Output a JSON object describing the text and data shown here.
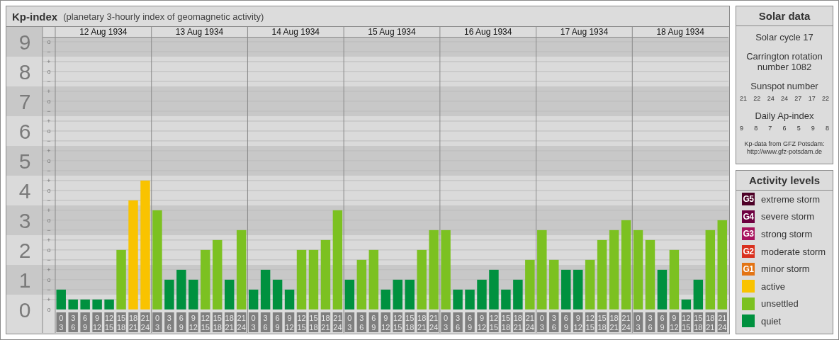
{
  "header": {
    "title": "Kp-index",
    "subtitle": "(planetary 3-hourly index of geomagnetic activity)"
  },
  "chart": {
    "dates": [
      "12 Aug 1934",
      "13 Aug 1934",
      "14 Aug 1934",
      "15 Aug 1934",
      "16 Aug 1934",
      "17 Aug 1934",
      "18 Aug 1934"
    ],
    "kp_signs": [
      "o",
      "−",
      "+",
      "o",
      "−",
      "+",
      "o",
      "−",
      "+",
      "o",
      "−",
      "+",
      "o",
      "−",
      "+",
      "o",
      "−",
      "+",
      "o",
      "−",
      "+",
      "o",
      "−",
      "+",
      "o",
      "−",
      "+",
      "o"
    ],
    "chart_data": {
      "type": "bar",
      "stacked": true,
      "grid": true,
      "categories": [
        "0\n3",
        "3\n6",
        "6\n9",
        "9\n12",
        "12\n15",
        "15\n18",
        "18\n21",
        "21\n24",
        "0\n3",
        "3\n6",
        "6\n9",
        "9\n12",
        "12\n15",
        "15\n18",
        "18\n21",
        "21\n24",
        "0\n3",
        "3\n6",
        "6\n9",
        "9\n12",
        "12\n15",
        "15\n18",
        "18\n21",
        "21\n24",
        "0\n3",
        "3\n6",
        "6\n9",
        "9\n12",
        "12\n15",
        "15\n18",
        "18\n21",
        "21\n24",
        "0\n3",
        "3\n6",
        "6\n9",
        "9\n12",
        "12\n15",
        "15\n18",
        "18\n21",
        "21\n24",
        "0\n3",
        "3\n6",
        "6\n9",
        "9\n12",
        "12\n15",
        "15\n18",
        "18\n21",
        "21\n24",
        "0\n3",
        "3\n6",
        "6\n9",
        "9\n12",
        "12\n15",
        "15\n18",
        "18\n21",
        "21\n24"
      ],
      "ylim": [
        -0.79,
        9.5
      ],
      "yticks": [
        0,
        1,
        2,
        3,
        4,
        5,
        6,
        7,
        8,
        9
      ],
      "series": [
        {
          "color": "#00913f",
          "values": [
            0.67,
            0.33,
            0.33,
            0.33,
            0.33,
            null,
            null,
            null,
            null,
            1,
            1.33,
            1,
            null,
            null,
            1,
            null,
            0.67,
            1.33,
            1,
            0.67,
            null,
            null,
            null,
            null,
            1,
            null,
            null,
            0.67,
            1,
            1,
            null,
            null,
            null,
            0.67,
            0.67,
            1,
            1.33,
            0.67,
            1,
            null,
            null,
            null,
            1.33,
            1.33,
            null,
            null,
            null,
            null,
            null,
            null,
            1.33,
            null,
            0.33,
            1,
            null,
            null
          ]
        },
        {
          "color": "#7cc121",
          "values": [
            null,
            null,
            null,
            null,
            null,
            2,
            null,
            null,
            3.33,
            null,
            null,
            null,
            2,
            2.33,
            null,
            2.67,
            null,
            null,
            null,
            null,
            2,
            2,
            2.33,
            3.33,
            null,
            1.67,
            2,
            null,
            null,
            null,
            2,
            2.67,
            2.67,
            null,
            null,
            null,
            null,
            null,
            null,
            1.67,
            2.67,
            1.67,
            null,
            null,
            1.67,
            2.33,
            2.67,
            3,
            2.67,
            2.33,
            null,
            2,
            null,
            null,
            2.67,
            3
          ]
        },
        {
          "color": "#f9c300",
          "values": [
            null,
            null,
            null,
            null,
            null,
            null,
            3.67,
            4.33,
            null,
            null,
            null,
            null,
            null,
            null,
            null,
            null,
            null,
            null,
            null,
            null,
            null,
            null,
            null,
            null,
            null,
            null,
            null,
            null,
            null,
            null,
            null,
            null,
            null,
            null,
            null,
            null,
            null,
            null,
            null,
            null,
            null,
            null,
            null,
            null,
            null,
            null,
            null,
            null,
            null,
            null,
            null,
            null,
            null,
            null,
            null,
            null
          ]
        }
      ]
    }
  },
  "solar_data": {
    "title": "Solar data",
    "solar_cycle": "Solar cycle 17",
    "carrington": "Carrington rotation number 1082",
    "sunspot_label": "Sunspot number",
    "sunspot_values": [
      "21",
      "22",
      "24",
      "24",
      "27",
      "17",
      "22"
    ],
    "ap_label": "Daily Ap-index",
    "ap_values": [
      "9",
      "8",
      "7",
      "6",
      "5",
      "9",
      "8"
    ],
    "credit": "Kp-data from GFZ Potsdam:",
    "credit_url": "http://www.gfz-potsdam.de"
  },
  "activity_levels": {
    "title": "Activity levels",
    "items": [
      {
        "badge": "G5",
        "label": "extreme storm",
        "color": "#4d0026"
      },
      {
        "badge": "G4",
        "label": "severe storm",
        "color": "#6e0040"
      },
      {
        "badge": "G3",
        "label": "strong storm",
        "color": "#a8135e"
      },
      {
        "badge": "G2",
        "label": "moderate storm",
        "color": "#d9301e"
      },
      {
        "badge": "G1",
        "label": "minor storm",
        "color": "#e37414"
      },
      {
        "label": "active",
        "color": "#f9c300"
      },
      {
        "label": "unsettled",
        "color": "#7cc121"
      },
      {
        "label": "quiet",
        "color": "#00913f"
      }
    ]
  }
}
